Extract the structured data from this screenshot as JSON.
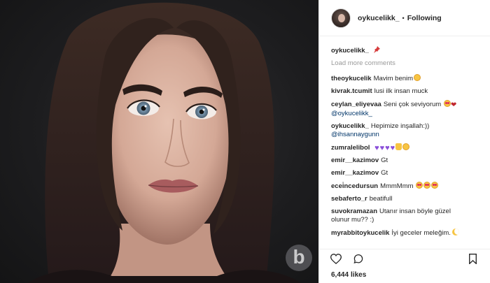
{
  "post": {
    "username": "oykucelikk_",
    "separator": "•",
    "follow_status": "Following",
    "load_more": "Load more comments",
    "likes_count": "6,444",
    "likes_label": "likes"
  },
  "comments": [
    {
      "user": "oykucelikk_",
      "text": "",
      "emoji": "pin"
    },
    {
      "user": "theoykucelik",
      "text": "Mavim benim",
      "emoji": "face"
    },
    {
      "user": "kivrak.tcumit",
      "text": "lusi ilk insan muck",
      "emoji": ""
    },
    {
      "user": "ceylan_eliyevaa",
      "text": "Seni çok seviyorum",
      "emoji": "heart-eyes+heart"
    },
    {
      "user": "",
      "text": "@oykucelikk_",
      "emoji": ""
    },
    {
      "user": "oykucelikk_",
      "text": "Hepimize inşallah:))",
      "emoji": ""
    },
    {
      "user": "",
      "text": "@ihsannaygunn",
      "emoji": ""
    },
    {
      "user": "zumralelibol",
      "text": "",
      "emoji": "purple-hearts"
    },
    {
      "user": "emir__kazimov",
      "text": "Gt",
      "emoji": ""
    },
    {
      "user": "emir__kazimov",
      "text": "Gt",
      "emoji": ""
    },
    {
      "user": "ecei̇ncedursun",
      "text": "MmmMmm",
      "emoji": "heart-eyes3"
    },
    {
      "user": "sebaferto_r",
      "text": "beatifull",
      "emoji": ""
    },
    {
      "user": "suvokramazan",
      "text": "Utanır insan böyle güzel",
      "emoji": ""
    },
    {
      "user": "",
      "text": "olunur mu?? :)",
      "emoji": ""
    },
    {
      "user": "myrabbitoykucelik",
      "text": "İyi geceler meleğim.",
      "emoji": "moon"
    }
  ],
  "icons": {
    "like": "heart-outline-icon",
    "comment": "comment-bubble-icon",
    "save": "bookmark-icon"
  },
  "colors": {
    "text": "#262626",
    "muted": "#999999",
    "mention": "#003569",
    "border": "#efefef"
  }
}
